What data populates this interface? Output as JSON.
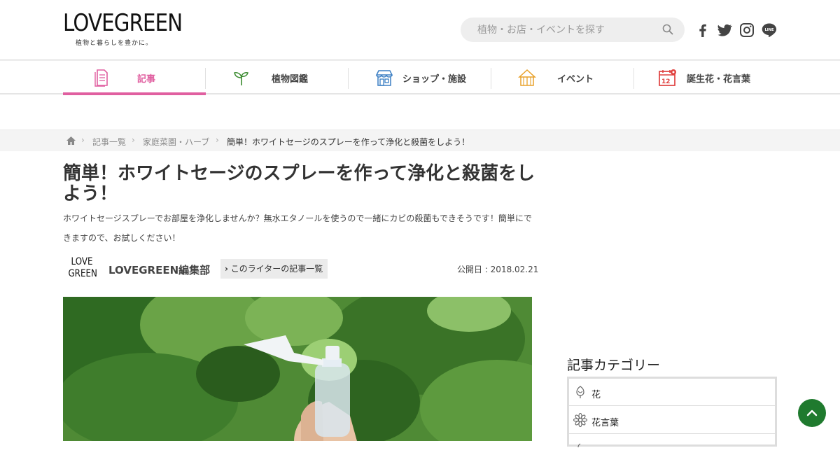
{
  "header": {
    "logo": "LOVEGREEN",
    "logo_tagline": "植物と暮らしを豊かに。",
    "search": {
      "placeholder": "植物・お店・イベントを探す"
    },
    "social": [
      "facebook-icon",
      "twitter-icon",
      "instagram-icon",
      "line-icon"
    ]
  },
  "nav": {
    "items": [
      {
        "label": "記事",
        "icon": "article-icon",
        "active": true
      },
      {
        "label": "植物図鑑",
        "icon": "sprout-icon",
        "active": false
      },
      {
        "label": "ショップ・施設",
        "icon": "shop-icon",
        "active": false
      },
      {
        "label": "イベント",
        "icon": "tent-icon",
        "active": false
      },
      {
        "label": "誕生花・花言葉",
        "icon": "calendar-icon",
        "active": false
      }
    ]
  },
  "breadcrumb": {
    "items": [
      "記事一覧",
      "家庭菜園・ハーブ",
      "簡単！ホワイトセージのスプレーを作って浄化と殺菌をしよう！"
    ]
  },
  "article": {
    "title": "簡単！ホワイトセージのスプレーを作って浄化と殺菌をしよう！",
    "lead": "ホワイトセージスプレーでお部屋を浄化しませんか？無水エタノールを使うので一緒にカビの殺菌もできそうです！簡単にできますので、お試しください！",
    "author_logo_line1": "LOVE",
    "author_logo_line2": "GREEN",
    "author_name": "LOVEGREEN編集部",
    "writer_link": "このライターの記事一覧",
    "published": "公開日 : 2018.02.21"
  },
  "sidebar": {
    "category_title": "記事カテゴリー",
    "categories": [
      {
        "label": "花",
        "icon": "flower-bud-icon"
      },
      {
        "label": "花言葉",
        "icon": "daisy-icon"
      }
    ]
  },
  "colors": {
    "accent": "#e05fa0",
    "green": "#1f7a2e"
  }
}
